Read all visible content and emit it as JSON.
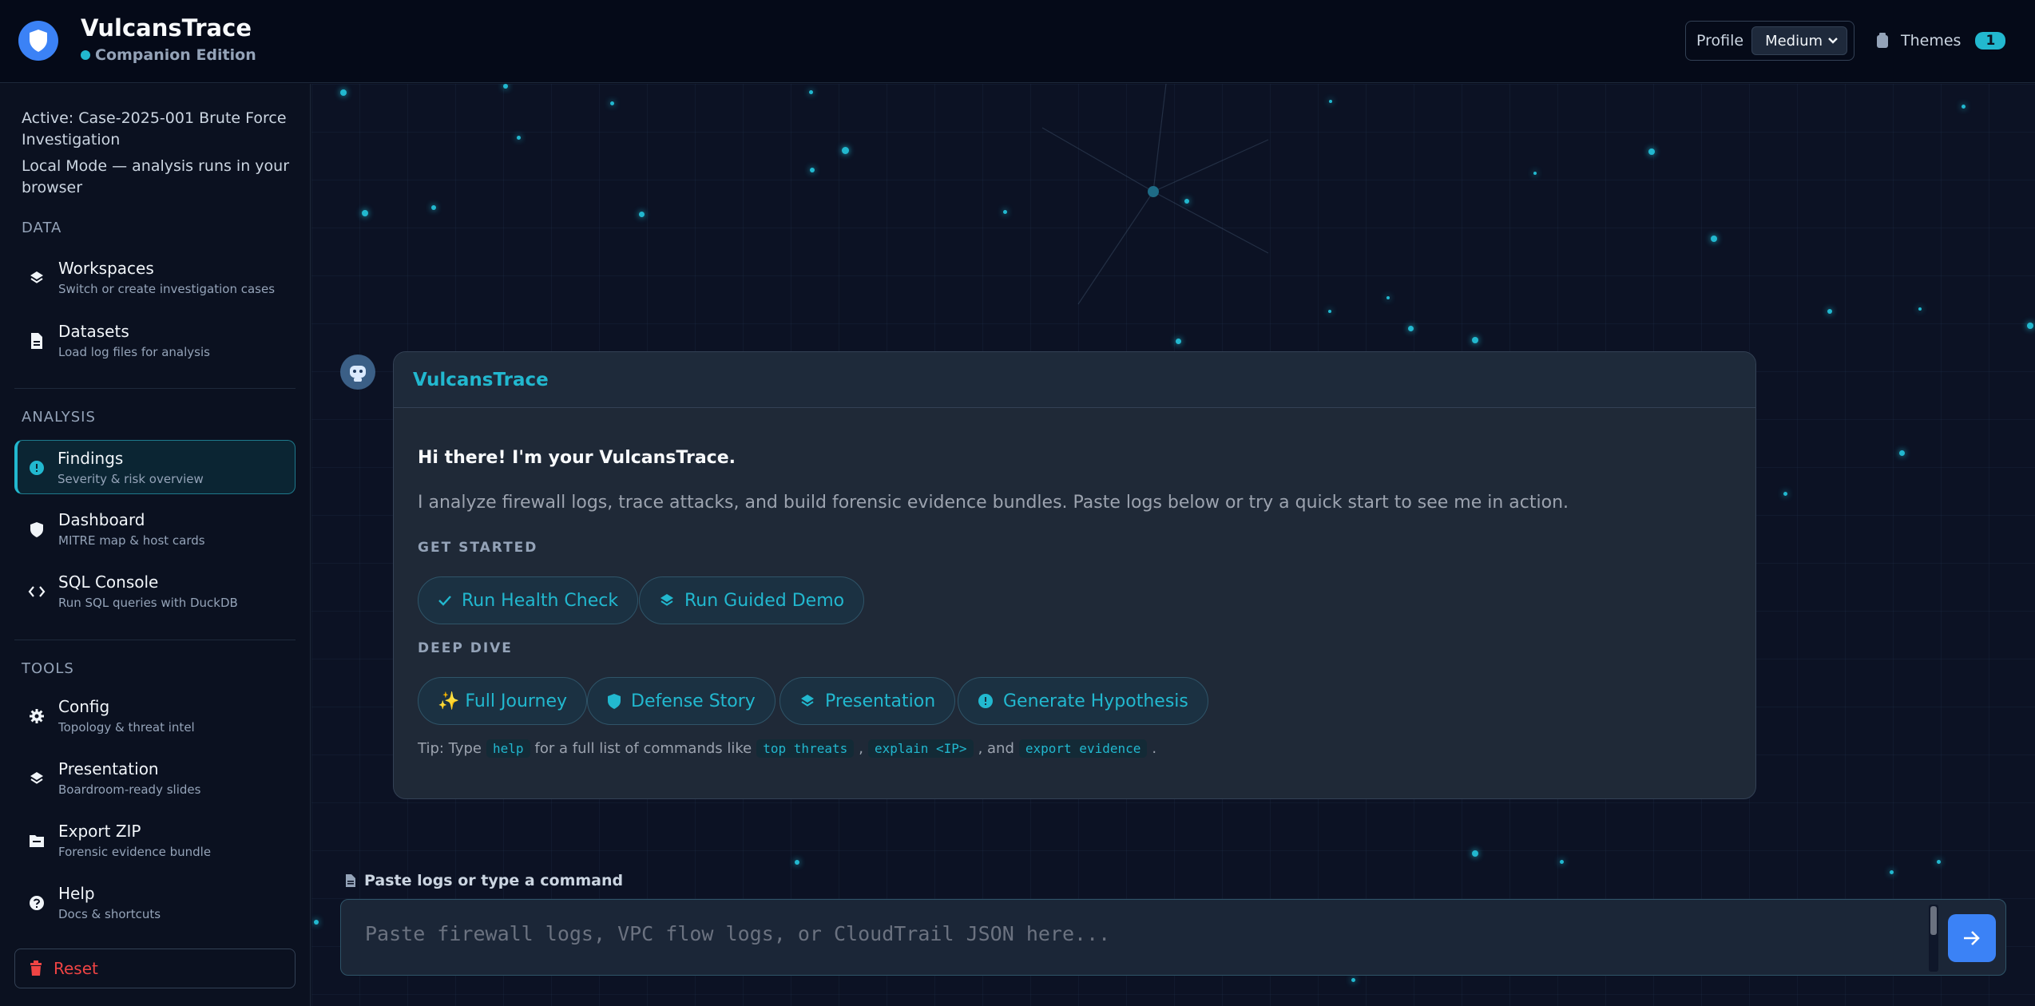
{
  "header": {
    "title": "VulcansTrace",
    "edition": "Companion Edition",
    "profile_label": "Profile",
    "profile_value": "Medium",
    "themes_label": "Themes",
    "themes_count": "1"
  },
  "sidebar": {
    "active_case": "Active: Case-2025-001 Brute Force Investigation",
    "mode_note": "Local Mode — analysis runs in your browser",
    "sections": {
      "data": "DATA",
      "analysis": "ANALYSIS",
      "tools": "TOOLS"
    },
    "items": [
      {
        "label": "Workspaces",
        "sub": "Switch or create investigation cases",
        "icon": "layers-icon"
      },
      {
        "label": "Datasets",
        "sub": "Load log files for analysis",
        "icon": "file-icon"
      },
      {
        "label": "Findings",
        "sub": "Severity & risk overview",
        "icon": "alert-icon"
      },
      {
        "label": "Dashboard",
        "sub": "MITRE map & host cards",
        "icon": "shield-icon"
      },
      {
        "label": "SQL Console",
        "sub": "Run SQL queries with DuckDB",
        "icon": "code-icon"
      },
      {
        "label": "Config",
        "sub": "Topology & threat intel",
        "icon": "gear-icon"
      },
      {
        "label": "Presentation",
        "sub": "Boardroom-ready slides",
        "icon": "layers-icon"
      },
      {
        "label": "Export ZIP",
        "sub": "Forensic evidence bundle",
        "icon": "archive-icon"
      },
      {
        "label": "Help",
        "sub": "Docs & shortcuts",
        "icon": "help-icon"
      }
    ],
    "reset_label": "Reset"
  },
  "chat": {
    "bot_name": "VulcansTrace",
    "greeting": "Hi there! I'm your VulcansTrace.",
    "intro": "I analyze firewall logs, trace attacks, and build forensic evidence bundles. Paste logs below or try a quick start to see me in action.",
    "get_started_label": "GET STARTED",
    "get_started": [
      "Run Health Check",
      "Run Guided Demo"
    ],
    "deep_dive_label": "DEEP DIVE",
    "deep_dive": [
      "✨ Full Journey",
      "Defense Story",
      "Presentation",
      "Generate Hypothesis"
    ],
    "tip": {
      "prefix": "Tip: Type",
      "cmd_help": "help",
      "middle": "for a full list of commands like",
      "cmd1": "top threats",
      "sep": ",",
      "cmd2": "explain <IP>",
      "and": ", and",
      "cmd3": "export evidence",
      "end": "."
    }
  },
  "composer": {
    "label": "Paste logs or type a command",
    "placeholder": "Paste firewall logs, VPC flow logs, or CloudTrail JSON here..."
  },
  "colors": {
    "accent": "#22b8cf",
    "primary": "#3b82f6",
    "danger": "#ef4444"
  }
}
